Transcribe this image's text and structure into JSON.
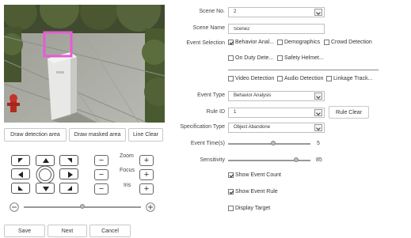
{
  "video": {
    "detection_box_color": "#e85ad6"
  },
  "area_buttons": {
    "draw_detection": "Draw detection area",
    "draw_masked": "Draw masked area",
    "line_clear": "Line Clear"
  },
  "ptz": {
    "zoom_label": "Zoom",
    "focus_label": "Focus",
    "iris_label": "Iris",
    "minus": "−",
    "plus": "+",
    "speed_level": 0.5
  },
  "footer": {
    "save": "Save",
    "next": "Next",
    "cancel": "Cancel"
  },
  "form": {
    "scene_no_label": "Scene No.",
    "scene_no_value": "2",
    "scene_name_label": "Scene Name",
    "scene_name_value": "Scene2",
    "event_selection_label": "Event Selection",
    "events": [
      {
        "label": "Behavior Anal...",
        "checked": true
      },
      {
        "label": "Demographics",
        "checked": false
      },
      {
        "label": "Crowd Detection",
        "checked": false
      },
      {
        "label": "On Duty Dete...",
        "checked": false
      },
      {
        "label": "Safety Helmet...",
        "checked": false
      },
      {
        "label": "Video Detection",
        "checked": false
      },
      {
        "label": "Audio Detection",
        "checked": false
      },
      {
        "label": "Linkage Track...",
        "checked": false
      }
    ],
    "event_type_label": "Event Type",
    "event_type_value": "Behavior Analysis",
    "rule_id_label": "Rule ID",
    "rule_id_value": "1",
    "rule_clear": "Rule Clear",
    "spec_type_label": "Specification Type",
    "spec_type_value": "Object Abandone",
    "event_time_label": "Event Time(s)",
    "event_time_value": "5",
    "event_time_level": 0.55,
    "sensitivity_label": "Sensitivity",
    "sensitivity_value": "85",
    "sensitivity_level": 0.85,
    "show_event_count": {
      "label": "Show Event Count",
      "checked": true
    },
    "show_event_rule": {
      "label": "Show Event Rule",
      "checked": true
    },
    "display_target": {
      "label": "Display Target",
      "checked": false
    }
  }
}
